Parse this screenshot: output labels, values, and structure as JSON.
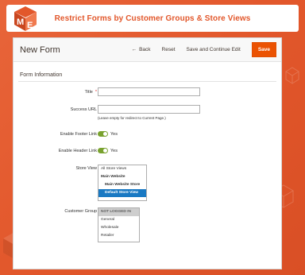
{
  "banner": {
    "title": "Restrict Forms by Customer Groups & Store Views"
  },
  "header": {
    "title": "New Form",
    "back_label": "Back",
    "reset_label": "Reset",
    "save_continue_label": "Save and Continue Edit",
    "save_label": "Save"
  },
  "section": {
    "title": "Form Information"
  },
  "fields": {
    "title_label": "Title",
    "title_required": "*",
    "title_value": "",
    "success_url_label": "Success URL",
    "success_url_value": "",
    "success_url_note": "(Leave empty for redirect to Current Page.)",
    "footer_link_label": "Enable Footer Link",
    "footer_link_value": "Yes",
    "header_link_label": "Enable Header Link",
    "header_link_value": "Yes",
    "store_view_label": "Store View",
    "store_view_options": [
      "All Store Views",
      "Main Website",
      "Main Website Store",
      "Default Store View"
    ],
    "customer_group_label": "Customer Group",
    "customer_group_options": [
      "NOT LOGGED IN",
      "General",
      "Wholesale",
      "Retailer"
    ]
  },
  "colors": {
    "accent": "#eb5202",
    "toggle_on": "#79a22e",
    "selected": "#1979c3",
    "brand": "#e2572b"
  }
}
